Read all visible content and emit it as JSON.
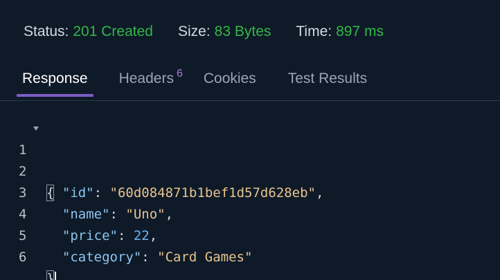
{
  "status_bar": {
    "status_label": "Status:",
    "status_value": "201 Created",
    "size_label": "Size:",
    "size_value": "83 Bytes",
    "time_label": "Time:",
    "time_value": "897 ms"
  },
  "tabs": [
    {
      "label": "Response",
      "active": true
    },
    {
      "label": "Headers",
      "badge": "6"
    },
    {
      "label": "Cookies"
    },
    {
      "label": "Test Results"
    }
  ],
  "editor": {
    "line_numbers": [
      "1",
      "2",
      "3",
      "4",
      "5",
      "6"
    ],
    "open_brace": "{",
    "close_brace": "}",
    "fields": [
      {
        "key": "\"id\"",
        "value": "\"60d084871b1bef1d57d628eb\"",
        "type": "string"
      },
      {
        "key": "\"name\"",
        "value": "\"Uno\"",
        "type": "string"
      },
      {
        "key": "\"price\"",
        "value": "22",
        "type": "number"
      },
      {
        "key": "\"category\"",
        "value": "\"Card Games\"",
        "type": "string"
      }
    ]
  },
  "colors": {
    "success": "#35b648",
    "accent": "#7c5cc4",
    "badge": "#a77bdc",
    "key": "#8ec5ee",
    "string": "#e8c38e",
    "number": "#6cb6f5",
    "background": "#0e1a28"
  },
  "icons": {
    "fold": "chevron-down-icon"
  }
}
